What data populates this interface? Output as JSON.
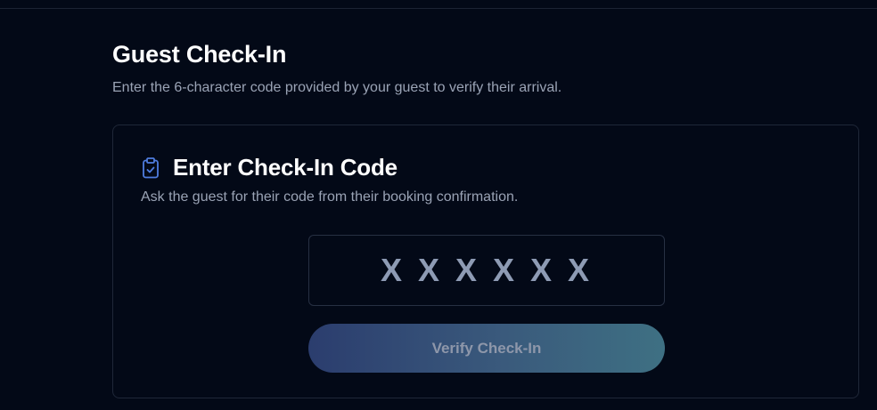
{
  "header": {
    "title": "Guest Check-In",
    "subtitle": "Enter the 6-character code provided by your guest to verify their arrival."
  },
  "card": {
    "icon": "clipboard-check-icon",
    "title": "Enter Check-In Code",
    "description": "Ask the guest for their code from their booking confirmation.",
    "code_input": {
      "value": "",
      "placeholder": "X X X X X X"
    },
    "verify_button_label": "Verify Check-In"
  },
  "colors": {
    "background": "#030917",
    "accent_icon": "#4f7de0",
    "button_gradient_start": "#2b3d6e",
    "button_gradient_end": "#3e7083"
  }
}
